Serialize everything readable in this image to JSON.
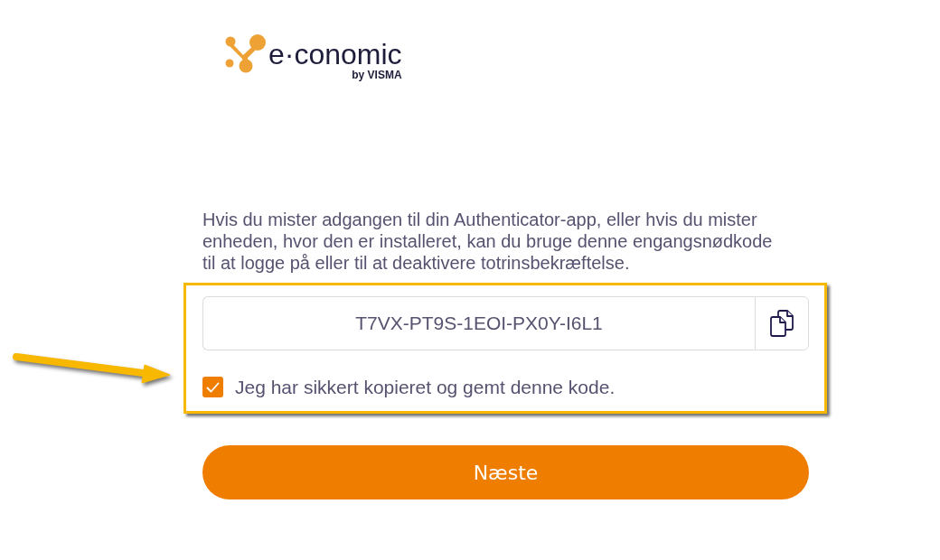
{
  "logo": {
    "wordmark": "e·conomic",
    "byline": "by VISMA"
  },
  "instructions": "Hvis du mister adgangen til din Authenticator-app, eller hvis du mister enheden, hvor den er installeret, kan du bruge denne engangsnødkode til at logge på eller til at deaktivere totrinsbekræftelse.",
  "recovery_code": {
    "value": "T7VX-PT9S-1EOI-PX0Y-I6L1"
  },
  "confirmation": {
    "label": "Jeg har sikkert kopieret og gemt denne kode.",
    "checked": true
  },
  "next_button": {
    "label": "Næste"
  }
}
